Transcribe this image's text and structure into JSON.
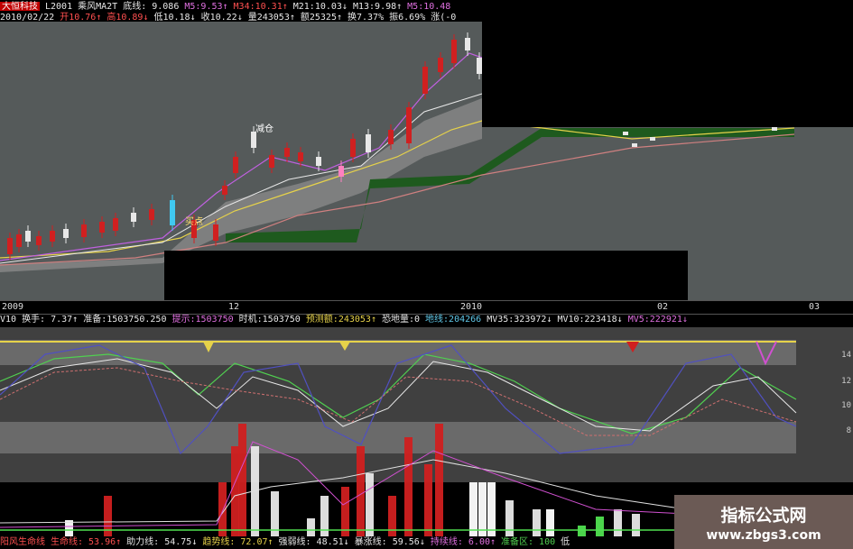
{
  "header": {
    "line1": [
      {
        "text": "大恒科技",
        "cls": "box"
      },
      {
        "text": "L2001",
        "cls": "c-w"
      },
      {
        "text": "乘风MA2T",
        "cls": "c-w"
      },
      {
        "text": "底线: 9.086",
        "cls": "c-w"
      },
      {
        "text": "M5:9.53↑",
        "cls": "c-m"
      },
      {
        "text": "M34:10.31↑",
        "cls": "c-r"
      },
      {
        "text": "M21:10.03↓",
        "cls": "c-w"
      },
      {
        "text": "M13:9.98↑",
        "cls": "c-w"
      },
      {
        "text": "M5:10.48",
        "cls": "c-m"
      }
    ],
    "line2": [
      {
        "text": "2010/02/22",
        "cls": "c-w"
      },
      {
        "text": "开10.76↑",
        "cls": "c-r"
      },
      {
        "text": "高10.89↓",
        "cls": "c-r"
      },
      {
        "text": "低10.18↓",
        "cls": "c-w"
      },
      {
        "text": "收10.22↓",
        "cls": "c-w"
      },
      {
        "text": "量243053↑",
        "cls": "c-w"
      },
      {
        "text": "额25325↑",
        "cls": "c-w"
      },
      {
        "text": "换7.37%",
        "cls": "c-w"
      },
      {
        "text": "振6.69%",
        "cls": "c-w"
      },
      {
        "text": "涨(-0",
        "cls": "c-w"
      }
    ]
  },
  "annotations": {
    "reduce": "减仓",
    "buy": "买点"
  },
  "date_axis": [
    "2009",
    "12",
    "2010",
    "02",
    "03"
  ],
  "indicator_bar": [
    {
      "text": "V10",
      "cls": "c-w"
    },
    {
      "text": "换手: 7.37↑",
      "cls": "c-w"
    },
    {
      "text": "准备:1503750.250",
      "cls": "c-w"
    },
    {
      "text": "提示:1503750",
      "cls": "c-m"
    },
    {
      "text": "时机:1503750",
      "cls": "c-w"
    },
    {
      "text": "预测额:243053↑",
      "cls": "c-y"
    },
    {
      "text": "恐地量:0",
      "cls": "c-w"
    },
    {
      "text": "地线:204266",
      "cls": "c-c"
    },
    {
      "text": "MV35:323972↓",
      "cls": "c-w"
    },
    {
      "text": "MV10:223418↓",
      "cls": "c-w"
    },
    {
      "text": "MV5:222921↓",
      "cls": "c-m"
    }
  ],
  "bottom_bar": [
    {
      "text": "阳风生命线",
      "cls": "c-r"
    },
    {
      "text": "生命线: 53.96↑",
      "cls": "c-r"
    },
    {
      "text": "助力线: 54.75↓",
      "cls": "c-w"
    },
    {
      "text": "趋势线: 72.07↑",
      "cls": "c-y"
    },
    {
      "text": "强弱线: 48.51↓",
      "cls": "c-w"
    },
    {
      "text": "暴涨线: 59.56↓",
      "cls": "c-w"
    },
    {
      "text": "持续线: 6.00↑",
      "cls": "c-m"
    },
    {
      "text": "准备区: 100",
      "cls": "c-g"
    },
    {
      "text": "低",
      "cls": "c-w"
    }
  ],
  "y_labels": [
    "14",
    "12",
    "10",
    "8"
  ],
  "watermark": {
    "line1": "指标公式网",
    "line2": "www.zbgs3.com"
  },
  "colors": {
    "up": "#d02020",
    "down": "#e8e8e8",
    "bg": "#555a5a",
    "cloud": "#8c8c8c",
    "green": "#1e5a1e"
  }
}
